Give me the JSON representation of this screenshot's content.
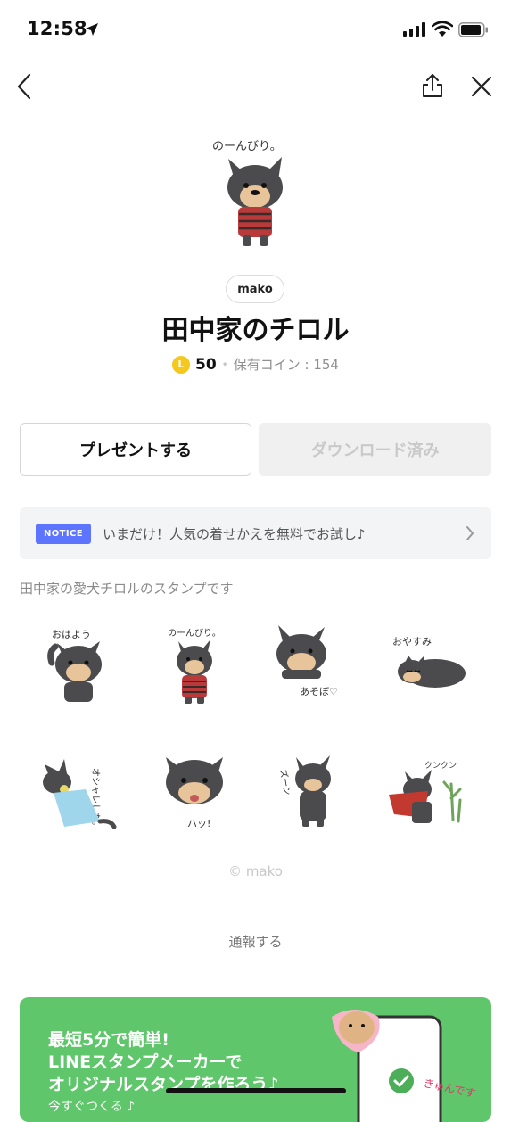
{
  "status_bar": {
    "time": "12:58"
  },
  "header": {
    "back_label": "",
    "share_label": "",
    "close_label": ""
  },
  "product": {
    "author": "mako",
    "title": "田中家のチロル",
    "coin_symbol": "L",
    "price": "50",
    "owned_coins": "保有コイン : 154",
    "hero_caption": "のーんびり。"
  },
  "actions": {
    "gift_label": "プレゼントする",
    "download_label": "ダウンロード済み"
  },
  "notice": {
    "badge": "NOTICE",
    "text": "いまだけ！人気の着せかえを無料でお試し♪"
  },
  "description": "田中家の愛犬チロルのスタンプです",
  "stickers": [
    {
      "icon": "dog-waving-sticker",
      "caption": "おはよう"
    },
    {
      "icon": "dog-sweater-sticker",
      "caption": "のーんびり。"
    },
    {
      "icon": "dog-play-sticker",
      "caption": "あそぼ♡"
    },
    {
      "icon": "dog-sleeping-sticker",
      "caption": "おやすみ"
    },
    {
      "icon": "dog-dress-sticker",
      "caption": "オシャレした。"
    },
    {
      "icon": "dog-pant-sticker",
      "caption": "ハッ!"
    },
    {
      "icon": "dog-gloomy-sticker",
      "caption": "ズーン"
    },
    {
      "icon": "dog-cape-sticker",
      "caption": "クンクン"
    }
  ],
  "copyright": "© mako",
  "report_label": "通報する",
  "banner": {
    "line1": "最短5分で簡単!",
    "line2": "LINEスタンプメーカーで",
    "line3": "オリジナルスタンプを作ろう♪",
    "cta": "今すぐつくる ♪",
    "sticker_caption": "きゅんです",
    "color": "#5fc66b"
  },
  "colors": {
    "notice_badge": "#5d74ff",
    "coin": "#f4c81c",
    "banner": "#5fc66b"
  }
}
